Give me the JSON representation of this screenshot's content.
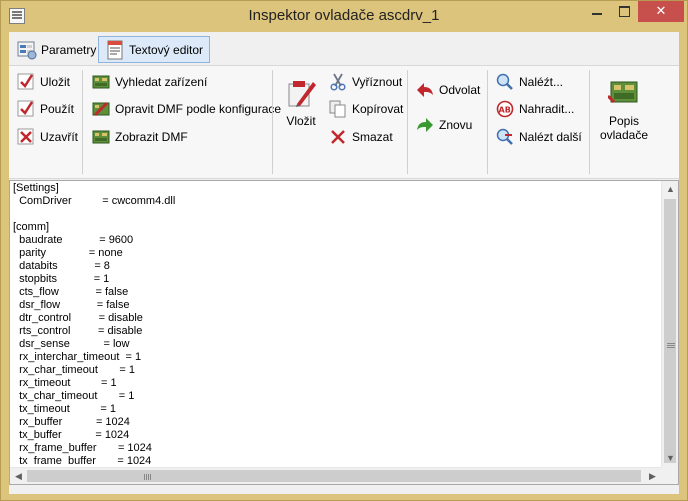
{
  "window": {
    "title": "Inspektor ovladače ascdrv_1"
  },
  "tabs": [
    {
      "label": "Parametry"
    },
    {
      "label": "Textový editor"
    }
  ],
  "ribbon": {
    "file": {
      "save": "Uložit",
      "apply": "Použít",
      "close": "Uzavřít"
    },
    "dmf": {
      "find_device": "Vyhledat zařízení",
      "repair_dmf": "Opravit DMF podle konfigurace",
      "show_dmf": "Zobrazit DMF"
    },
    "clipboard": {
      "paste": "Vložit",
      "cut": "Vyříznout",
      "copy": "Kopírovat",
      "delete": "Smazat"
    },
    "history": {
      "undo": "Odvolat",
      "redo": "Znovu"
    },
    "search": {
      "find": "Naléźt...",
      "replace": "Nahradit...",
      "find_next": "Nalézt další"
    },
    "driver": {
      "description": "Popis ovladače"
    }
  },
  "editor": {
    "lines": [
      "[Settings]",
      "  ComDriver          = cwcomm4.dll",
      "",
      "[comm]",
      "  baudrate            = 9600",
      "  parity              = none",
      "  databits            = 8",
      "  stopbits            = 1",
      "  cts_flow            = false",
      "  dsr_flow            = false",
      "  dtr_control         = disable",
      "  rts_control         = disable",
      "  dsr_sense           = low",
      "  rx_interchar_timeout  = 1",
      "  rx_char_timeout       = 1",
      "  rx_timeout          = 1",
      "  tx_char_timeout       = 1",
      "  tx_timeout          = 1",
      "  rx_buffer           = 1024",
      "  tx_buffer           = 1024",
      "  rx_frame_buffer       = 1024",
      "  tx_frame_buffer       = 1024"
    ]
  }
}
